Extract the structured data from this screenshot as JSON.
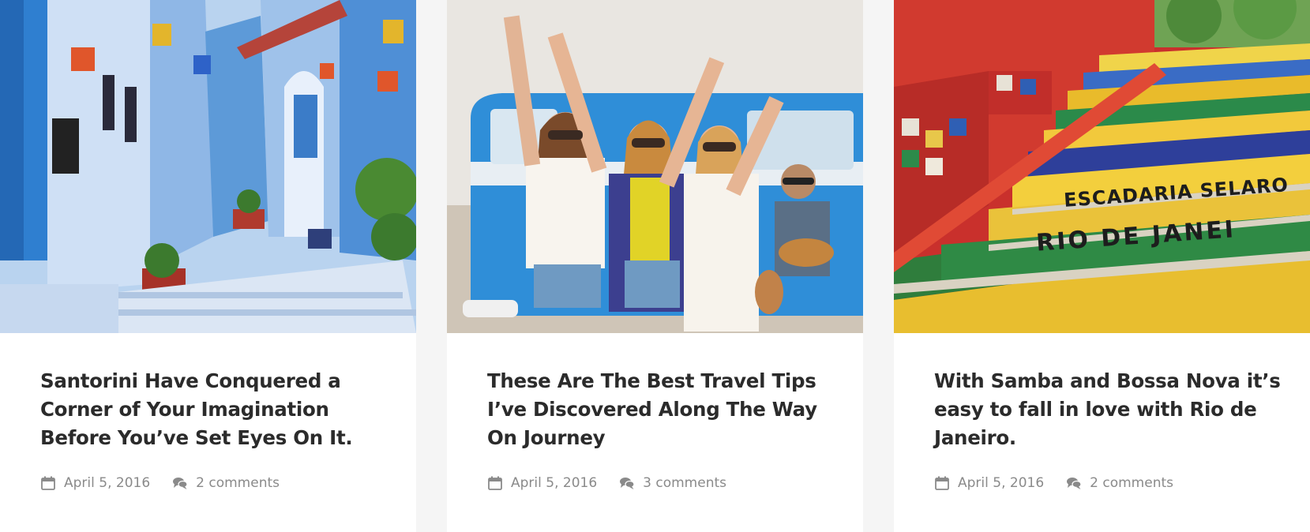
{
  "posts": [
    {
      "title": "Santorini Have Conquered a Corner of Your Imagination Before You’ve Set Eyes On It.",
      "date": "April 5, 2016",
      "comments": "2 comments",
      "image": "blue painted alley with stairs and flower pots"
    },
    {
      "title": "These Are The Best Travel Tips I’ve Discovered Along The Way On Journey",
      "date": "April 5, 2016",
      "comments": "3 comments",
      "image": "three women celebrating in front of a blue van"
    },
    {
      "title": "With Samba and Bossa Nova it’s easy to fall in love with Rio de Janeiro.",
      "date": "April 5, 2016",
      "comments": "2 comments",
      "image": "colorful tiled stairs Escadaria Selaron",
      "image_text": [
        "ESCADARIA SELARO",
        "RIO DE JANEI"
      ]
    }
  ],
  "icons": {
    "date": "calendar-icon",
    "comments": "comments-icon"
  },
  "colors": {
    "title": "#2b2b2b",
    "meta": "#8a8a8a",
    "background": "#f5f5f5",
    "card": "#ffffff"
  }
}
